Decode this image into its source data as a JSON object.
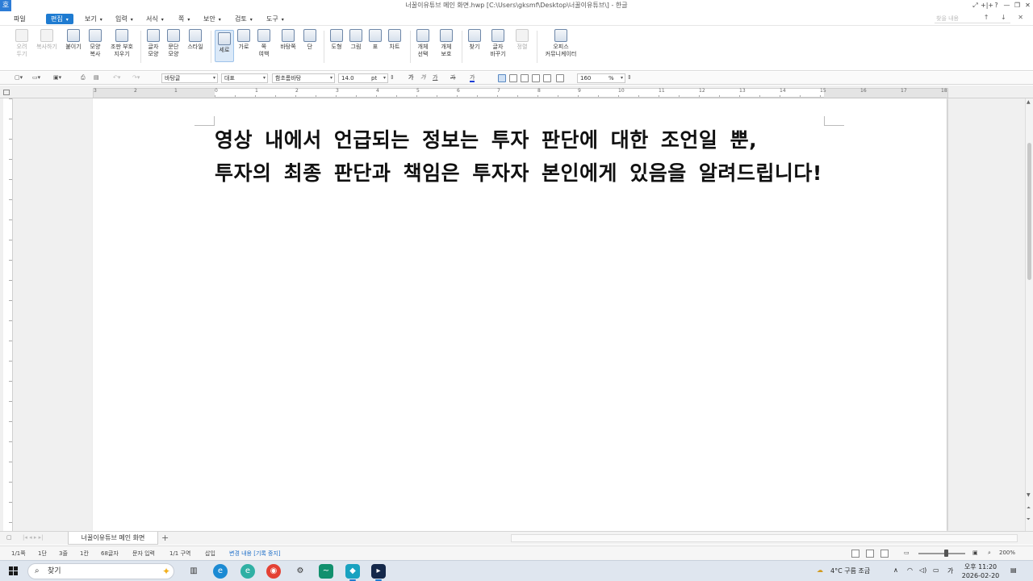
{
  "window": {
    "app_icon": "호",
    "title": "너꿀이유튜브 메인 화면.hwp [C:\\Users\\gksmf\\Desktop\\너꿀이유튜브\\] - 한글",
    "controls": [
      "⤢",
      "+|+",
      "?",
      "—",
      "❐",
      "✕"
    ]
  },
  "menu": {
    "items": [
      {
        "label": "파일"
      },
      {
        "label": "편집",
        "active": true
      },
      {
        "label": "보기"
      },
      {
        "label": "입력"
      },
      {
        "label": "서식"
      },
      {
        "label": "쪽"
      },
      {
        "label": "보안"
      },
      {
        "label": "검토"
      },
      {
        "label": "도구"
      }
    ],
    "help_placeholder": "찾을 내용",
    "right_icons": "↑ ↓ ✕"
  },
  "ribbon": {
    "cut": "오려\n두기",
    "copy": "복사하기",
    "paste": "붙이기",
    "format_copy": "모양\n복사",
    "clear_marks": "조판 부호\n지우기",
    "char_shape": "글자\n모양",
    "para_shape": "문단\n모양",
    "style": "스타일",
    "portrait": "세로",
    "landscape": "가로",
    "margins": "쪽\n여백",
    "background": "바탕쪽",
    "columns": "단",
    "shapes": "도형",
    "picture": "그림",
    "table": "표",
    "chart": "차트",
    "select_object": "개체\n선택",
    "protect_object": "개체\n보호",
    "find": "찾기",
    "replace": "글자\n바꾸기",
    "sort": "정렬",
    "office_comm": "오피스\n커뮤니케이터"
  },
  "format": {
    "style_name": "바탕글",
    "lang": "대표",
    "font": "함초롬바탕",
    "size": "14.0",
    "unit": "pt",
    "zoom": "160",
    "zoom_unit": "%",
    "bold": "가",
    "italic": "가",
    "underline": "가",
    "strike": "가",
    "color": "가"
  },
  "ruler_numbers": [
    "3",
    "2",
    "1",
    "0",
    "1",
    "2",
    "3",
    "4",
    "5",
    "6",
    "7",
    "8",
    "9",
    "10",
    "11",
    "12",
    "13",
    "14",
    "15",
    "16",
    "17",
    "18"
  ],
  "document": {
    "line1": "영상 내에서 언급되는 정보는 투자 판단에 대한 조언일 뿐,",
    "line2": "투자의 최종 판단과 책임은 투자자 본인에게 있음을 알려드립니다!"
  },
  "tabs": {
    "nav": "|◂ ◂ ▸ ▸|",
    "doc_tab": "너꿀이유튜브 메인 화면",
    "add": "+"
  },
  "status": {
    "page": "1/1쪽",
    "column": "1단",
    "line": "3줄",
    "char": "1칸",
    "count": "68글자",
    "mode": "문자 입력",
    "section": "1/1 구역",
    "insert": "삽입",
    "track": "변경 내용 [기록 중지]",
    "zoom": "200%"
  },
  "taskbar": {
    "search": "찾기",
    "weather": "4°C 구름 조금",
    "time": "오후 11:20",
    "date": "2026-02-20",
    "ime": "가"
  }
}
